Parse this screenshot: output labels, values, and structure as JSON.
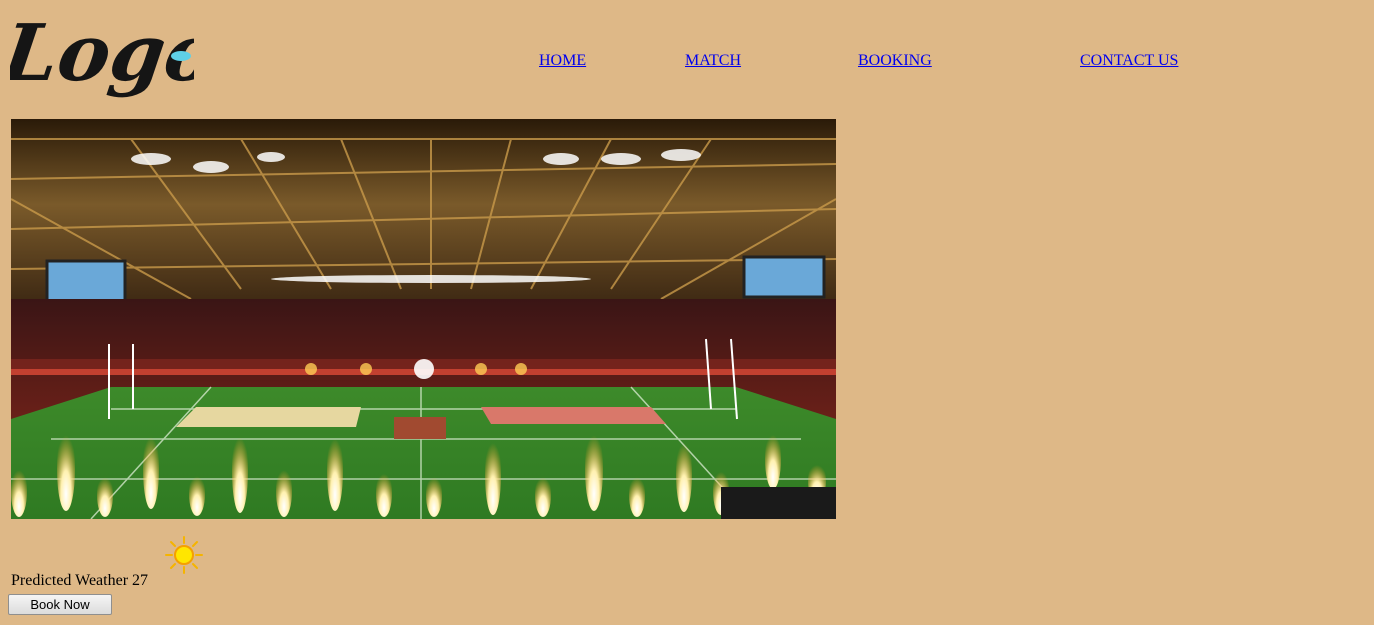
{
  "header": {
    "logo_text": "Logo",
    "logo_dot_color": "#5fd0e6"
  },
  "nav": {
    "items": [
      {
        "label": "HOME"
      },
      {
        "label": "MATCH"
      },
      {
        "label": "BOOKING"
      },
      {
        "label": "CONTACT US"
      }
    ],
    "link_color": "#0000ee"
  },
  "hero": {
    "image_subject": "stadium-interior-with-pyrotechnics"
  },
  "weather": {
    "icon": "sun-icon",
    "label": "Predicted Weather 27"
  },
  "actions": {
    "book_label": "Book Now"
  },
  "theme": {
    "background": "#deb887"
  }
}
